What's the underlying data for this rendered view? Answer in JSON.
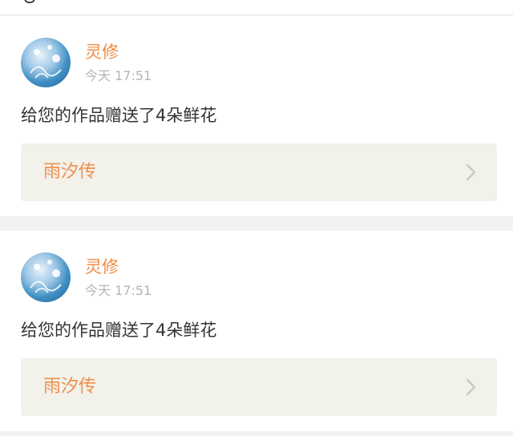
{
  "notifications": [
    {
      "user_name": "灵修",
      "time": "今天 17:51",
      "message": "给您的作品赠送了4朵鲜花",
      "work_title": "雨汐传"
    },
    {
      "user_name": "灵修",
      "time": "今天 17:51",
      "message": "给您的作品赠送了4朵鲜花",
      "work_title": "雨汐传"
    }
  ],
  "colors": {
    "accent": "#f08b45",
    "card_bg": "#ffffff",
    "page_bg": "#f2f2f2",
    "link_bg": "#f2f1ea"
  },
  "icons": {
    "avatar": "avatar-image",
    "chevron": "chevron-right-icon"
  }
}
